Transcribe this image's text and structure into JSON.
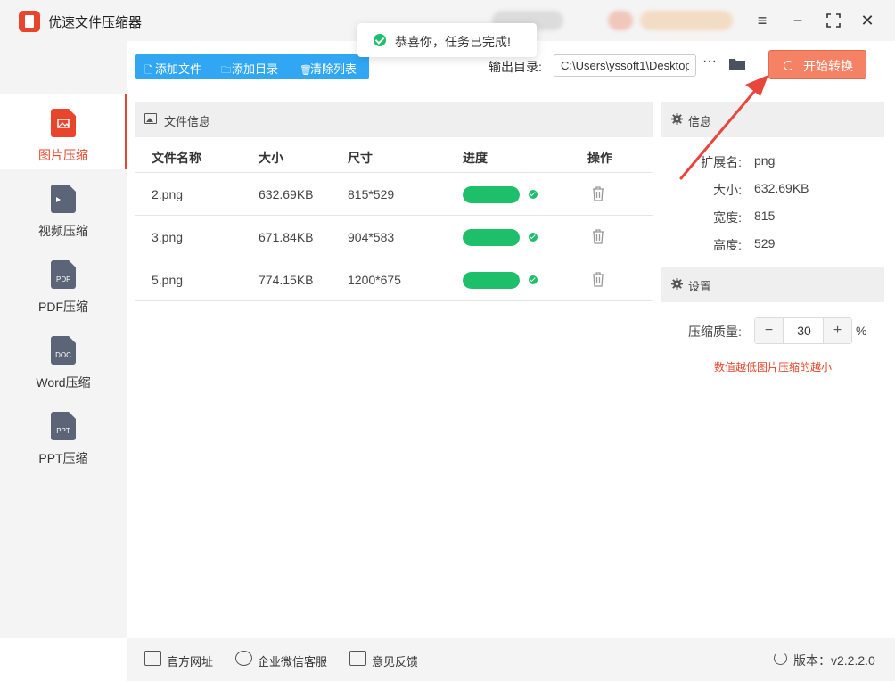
{
  "app": {
    "title": "优速文件压缩器"
  },
  "toast": {
    "message": "恭喜你，任务已完成!"
  },
  "window_controls": [
    "menu-icon",
    "minimize-icon",
    "maximize-icon",
    "close-icon"
  ],
  "sidebar": {
    "items": [
      {
        "label": "图片压缩",
        "icon": "image-file-icon",
        "tag": "",
        "active": true
      },
      {
        "label": "视频压缩",
        "icon": "video-file-icon",
        "tag": "",
        "active": false
      },
      {
        "label": "PDF压缩",
        "icon": "pdf-file-icon",
        "tag": "PDF",
        "active": false
      },
      {
        "label": "Word压缩",
        "icon": "doc-file-icon",
        "tag": "DOC",
        "active": false
      },
      {
        "label": "PPT压缩",
        "icon": "ppt-file-icon",
        "tag": "PPT",
        "active": false
      }
    ]
  },
  "toolbar": {
    "add_file": "添加文件",
    "add_dir": "添加目录",
    "clear_list": "清除列表",
    "output_label": "输出目录:",
    "output_path": "C:\\Users\\yssoft1\\Desktop",
    "start": "开始转换"
  },
  "file_panel": {
    "title": "文件信息",
    "columns": [
      "文件名称",
      "大小",
      "尺寸",
      "进度",
      "操作"
    ],
    "rows": [
      {
        "name": "2.png",
        "size": "632.69KB",
        "dimensions": "815*529",
        "progress": 1.0,
        "status": "done"
      },
      {
        "name": "3.png",
        "size": "671.84KB",
        "dimensions": "904*583",
        "progress": 1.0,
        "status": "done"
      },
      {
        "name": "5.png",
        "size": "774.15KB",
        "dimensions": "1200*675",
        "progress": 1.0,
        "status": "done"
      }
    ]
  },
  "info": {
    "title": "信息",
    "fields": [
      {
        "key": "扩展名:",
        "value": "png"
      },
      {
        "key": "大小:",
        "value": "632.69KB"
      },
      {
        "key": "宽度:",
        "value": "815"
      },
      {
        "key": "高度:",
        "value": "529"
      }
    ]
  },
  "settings": {
    "title": "设置",
    "quality_label": "压缩质量:",
    "quality_value": "30",
    "minus": "−",
    "plus": "+",
    "percent": "%",
    "hint": "数值越低图片压缩的越小"
  },
  "footer": {
    "website": "官方网址",
    "wechat": "企业微信客服",
    "feedback": "意见反馈",
    "version": "版本：v2.2.2.0"
  },
  "colors": {
    "accent": "#e8452c",
    "toolbar_blue": "#31a7f4",
    "start_button": "#f58264",
    "success_green": "#1ebf6a",
    "annotation_arrow": "#e8453c"
  }
}
